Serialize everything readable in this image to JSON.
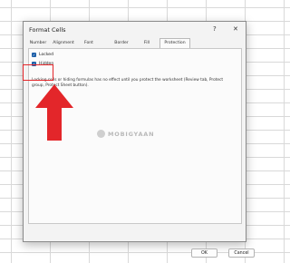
{
  "dialog": {
    "title": "Format Cells",
    "help_glyph": "?",
    "close_glyph": "✕"
  },
  "tabs": [
    {
      "label": "Number"
    },
    {
      "label": "Alignment"
    },
    {
      "label": "Font"
    },
    {
      "label": "Border"
    },
    {
      "label": "Fill"
    },
    {
      "label": "Protection",
      "active": true
    }
  ],
  "protection": {
    "locked": {
      "label": "Locked",
      "checked": true
    },
    "hidden": {
      "label": "Hidden",
      "checked": true
    },
    "info": "Locking cells or hiding formulas has no effect until you protect the worksheet (Review tab, Protect group, Protect Sheet button)."
  },
  "watermark": "MOBIGYAAN",
  "buttons": {
    "ok": "OK",
    "cancel": "Cancel"
  },
  "colors": {
    "accent": "#1d5fa8",
    "annotation": "#e3262a",
    "dialog_bg": "#f3f3f3"
  },
  "icons": {
    "check": "✓"
  }
}
